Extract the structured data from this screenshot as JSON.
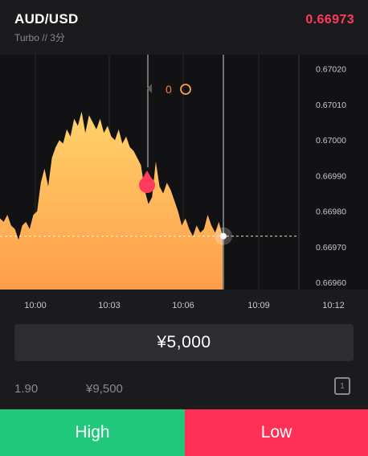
{
  "header": {
    "pair": "AUD/USD",
    "subtitle": "Turbo  //  3分",
    "current_price": "0.66973"
  },
  "chart": {
    "y_ticks": [
      "0.67020",
      "0.67010",
      "0.67000",
      "0.66990",
      "0.66980",
      "0.66970",
      "0.66960"
    ],
    "x_ticks": [
      "10:00",
      "10:03",
      "10:06",
      "10:09",
      "10:12"
    ],
    "position_count": "0"
  },
  "chart_data": {
    "type": "area",
    "x_label": "",
    "y_label": "",
    "ylim": [
      0.66958,
      0.67024
    ],
    "x_ticks": [
      "10:00",
      "10:03",
      "10:06",
      "10:09",
      "10:12"
    ],
    "current_price": 0.66973,
    "series": [
      {
        "values": [
          0.66978,
          0.66977,
          0.66979,
          0.66976,
          0.66975,
          0.66972,
          0.66976,
          0.66977,
          0.66975,
          0.66979,
          0.6698,
          0.66988,
          0.66992,
          0.66987,
          0.66995,
          0.66998,
          0.67,
          0.66999,
          0.67003,
          0.67001,
          0.67006,
          0.67004,
          0.67008,
          0.67002,
          0.67007,
          0.67005,
          0.67003,
          0.67006,
          0.67002,
          0.67004,
          0.67001,
          0.67,
          0.67003,
          0.66999,
          0.67001,
          0.66998,
          0.66997,
          0.66995,
          0.66993,
          0.66986,
          0.66982,
          0.66984,
          0.66994,
          0.66987,
          0.66985,
          0.66988,
          0.66986,
          0.66983,
          0.6698,
          0.66976,
          0.66978,
          0.66975,
          0.66973,
          0.66976,
          0.66974,
          0.66975,
          0.66979,
          0.66976,
          0.66974,
          0.66977,
          0.66973
        ]
      }
    ]
  },
  "trade": {
    "amount": "¥5,000",
    "payout_rate": "1.90",
    "payout_amount": "¥9,500",
    "page_icon_label": "1"
  },
  "buttons": {
    "high": "High",
    "low": "Low"
  },
  "colors": {
    "up": "#21c77a",
    "down": "#ff2f55",
    "price_red": "#ff3b5c",
    "area_top": "#ffd36b",
    "area_bottom": "#ff9d4a",
    "background": "#121214"
  }
}
